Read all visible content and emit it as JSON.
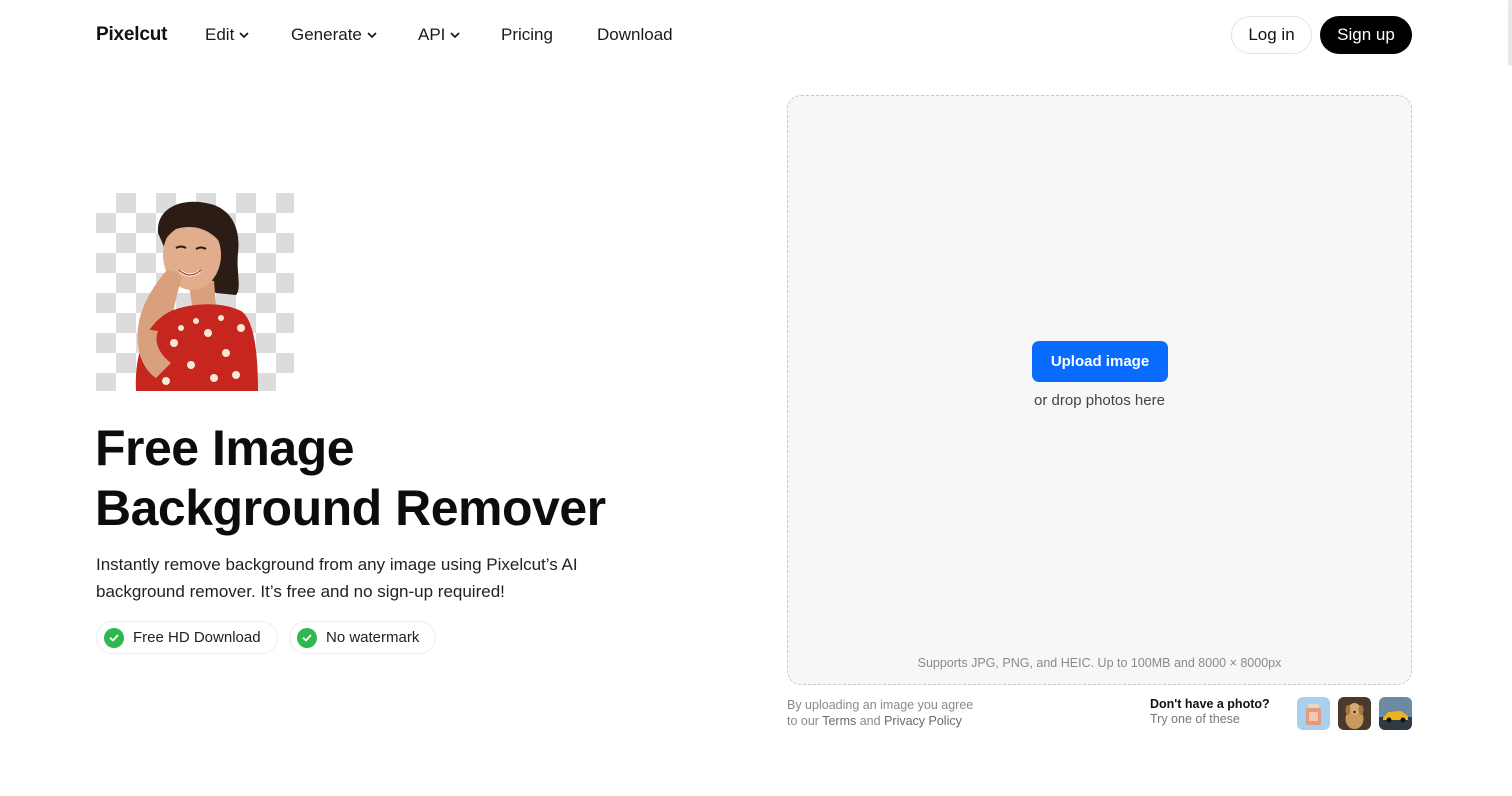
{
  "nav": {
    "logo": "Pixelcut",
    "items": [
      {
        "label": "Edit",
        "has_dropdown": true
      },
      {
        "label": "Generate",
        "has_dropdown": true
      },
      {
        "label": "API",
        "has_dropdown": true
      },
      {
        "label": "Pricing",
        "has_dropdown": false
      },
      {
        "label": "Download",
        "has_dropdown": false
      }
    ],
    "login_label": "Log in",
    "signup_label": "Sign up"
  },
  "hero": {
    "headline_line1": "Free Image",
    "headline_line2": "Background Remover",
    "subtext": "Instantly remove background from any image using Pixelcut’s AI background remover. It’s free and no sign-up required!",
    "badges": [
      {
        "label": "Free HD Download",
        "icon": "check-icon"
      },
      {
        "label": "No watermark",
        "icon": "check-icon"
      }
    ]
  },
  "upload": {
    "button_label": "Upload image",
    "drop_text": "or drop photos here",
    "supports_text": "Supports JPG, PNG, and HEIC. Up to 100MB and 8000 × 8000px",
    "legal_line1": "By uploading an image you agree",
    "legal_prefix": "to our ",
    "terms_label": "Terms",
    "and_text": " and ",
    "privacy_label": "Privacy Policy",
    "no_photo_title": "Don't have a photo?",
    "no_photo_sub": "Try one of these",
    "samples": [
      "product-bottle",
      "dog",
      "car"
    ]
  },
  "colors": {
    "accent": "#0a6cff",
    "check_green": "#2fb84f",
    "signup_bg": "#000000"
  }
}
